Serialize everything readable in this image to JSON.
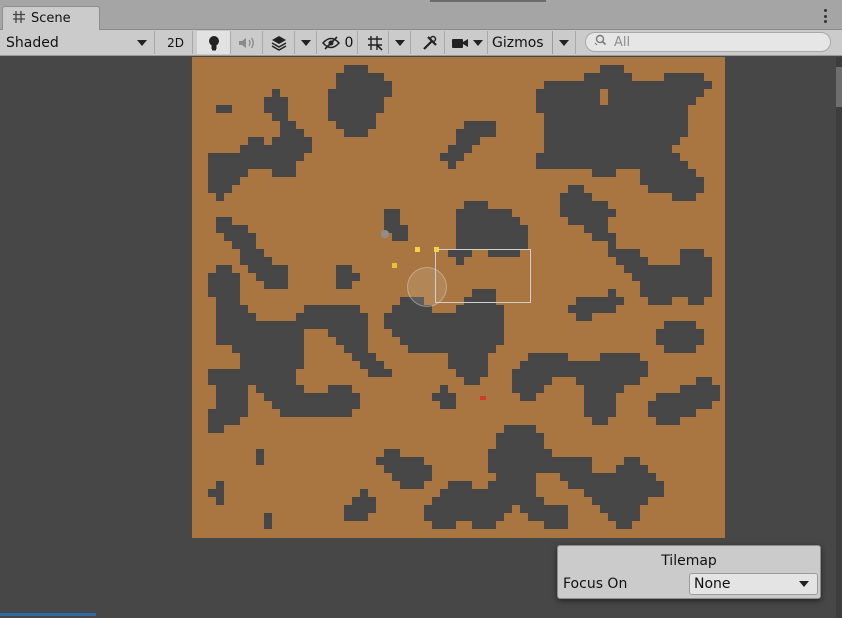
{
  "tab": {
    "label": "Scene",
    "icon": "scene-grid-icon"
  },
  "toolbar": {
    "draw_mode": "Shaded",
    "mode_2d": "2D",
    "hidden_count": "0",
    "gizmos_label": "Gizmos",
    "search_placeholder": "All"
  },
  "overlay": {
    "title": "Tilemap",
    "focus_label": "Focus On",
    "focus_value": "None"
  },
  "colors": {
    "sand": "#a97641",
    "rock": "#474747",
    "toolbar": "#cbcbcb",
    "tabbar": "#a5a5a5"
  }
}
